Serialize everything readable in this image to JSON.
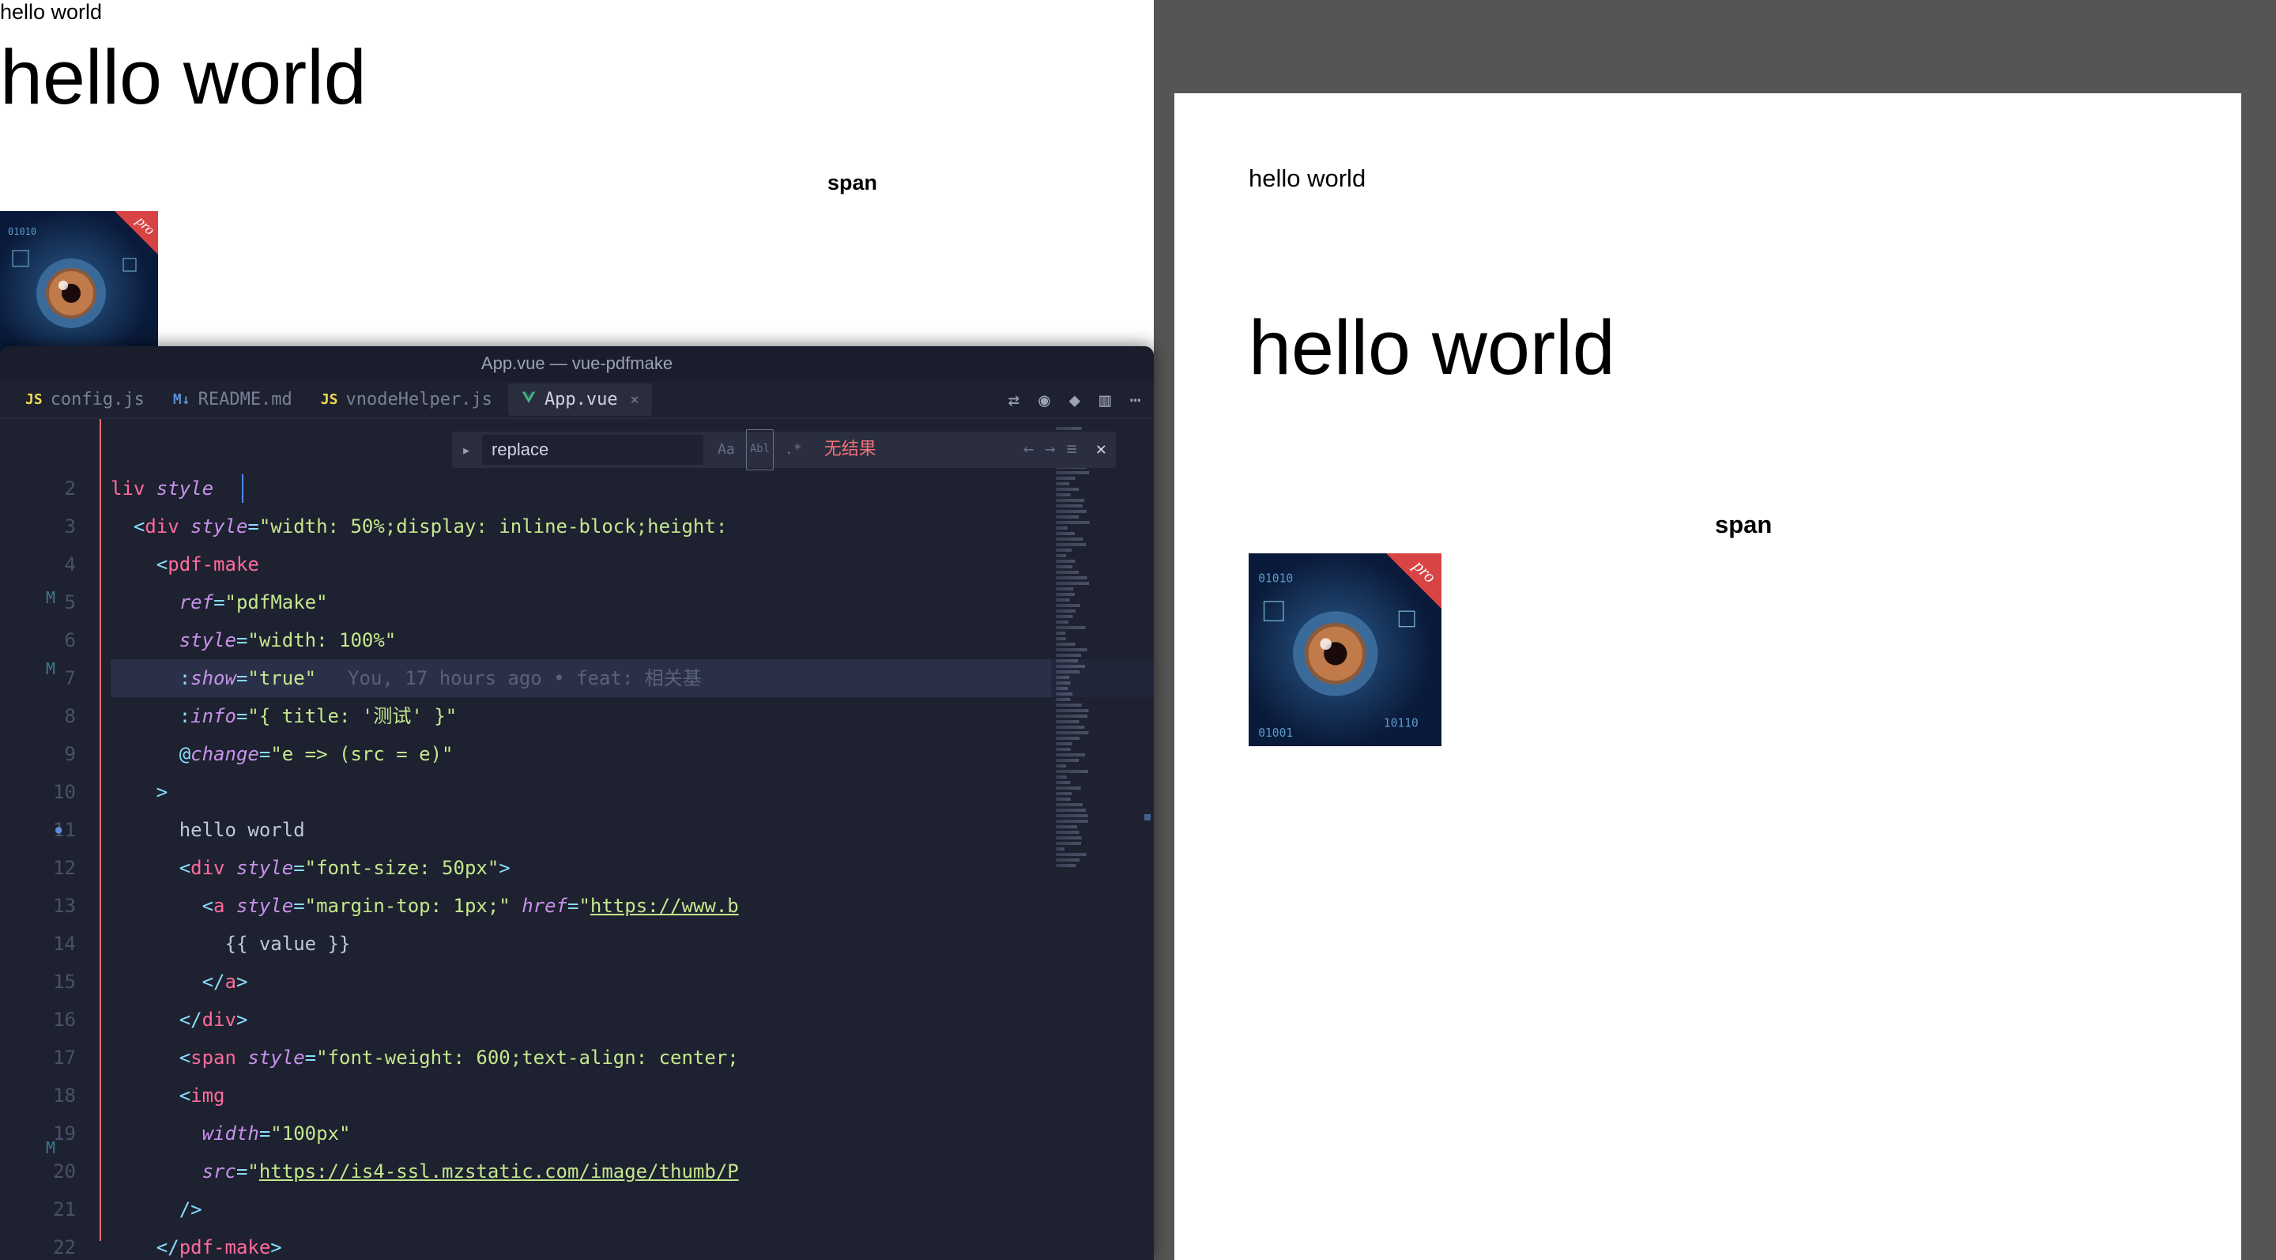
{
  "browser": {
    "text_small": "hello world",
    "text_big": "hello world",
    "span_label": "span"
  },
  "pdf": {
    "text_small": "hello world",
    "text_big": "hello world",
    "span_label": "span",
    "pro_badge": "pro"
  },
  "editor": {
    "title": "App.vue — vue-pdfmake",
    "tabs": [
      {
        "icon": "JS",
        "label": "config.js"
      },
      {
        "icon": "M↓",
        "label": "README.md"
      },
      {
        "icon": "JS",
        "label": "vnodeHelper.js"
      },
      {
        "icon": "V",
        "label": "App.vue",
        "active": true
      }
    ],
    "find": {
      "value": "replace",
      "result": "无结果"
    },
    "git_markers": {
      "m1": "M",
      "m2": "M",
      "m3": "M"
    },
    "blame": "You, 17 hours ago • feat: 相关基",
    "lines": [
      {
        "n": "2",
        "code_parts": [
          {
            "t": "liv ",
            "c": "tag"
          },
          {
            "t": "style",
            "c": "attr"
          }
        ],
        "raw": "liv style"
      },
      {
        "n": "3",
        "i": 1,
        "p": [
          {
            "t": "<",
            "c": "punc"
          },
          {
            "t": "div ",
            "c": "tag"
          },
          {
            "t": "style",
            "c": "attr"
          },
          {
            "t": "=",
            "c": "punc"
          },
          {
            "t": "\"width: 50%;display: inline-block;height:",
            "c": "str"
          }
        ]
      },
      {
        "n": "4",
        "i": 2,
        "p": [
          {
            "t": "<",
            "c": "punc"
          },
          {
            "t": "pdf-make",
            "c": "tag"
          }
        ]
      },
      {
        "n": "5",
        "i": 3,
        "p": [
          {
            "t": "ref",
            "c": "attr"
          },
          {
            "t": "=",
            "c": "punc"
          },
          {
            "t": "\"pdfMake\"",
            "c": "str"
          }
        ]
      },
      {
        "n": "6",
        "i": 3,
        "p": [
          {
            "t": "style",
            "c": "attr"
          },
          {
            "t": "=",
            "c": "punc"
          },
          {
            "t": "\"width: 100%\"",
            "c": "str"
          }
        ]
      },
      {
        "n": "7",
        "i": 3,
        "sel": true,
        "p": [
          {
            "t": ":",
            "c": "punc"
          },
          {
            "t": "show",
            "c": "attr"
          },
          {
            "t": "=",
            "c": "punc"
          },
          {
            "t": "\"true\"",
            "c": "str"
          }
        ],
        "blame": true
      },
      {
        "n": "8",
        "i": 3,
        "p": [
          {
            "t": ":",
            "c": "punc"
          },
          {
            "t": "info",
            "c": "attr"
          },
          {
            "t": "=",
            "c": "punc"
          },
          {
            "t": "\"{ title: '测试' }\"",
            "c": "str"
          }
        ]
      },
      {
        "n": "9",
        "i": 3,
        "p": [
          {
            "t": "@",
            "c": "punc"
          },
          {
            "t": "change",
            "c": "attr"
          },
          {
            "t": "=",
            "c": "punc"
          },
          {
            "t": "\"e => (src = e)\"",
            "c": "str"
          }
        ]
      },
      {
        "n": "10",
        "i": 2,
        "p": [
          {
            "t": ">",
            "c": "punc"
          }
        ]
      },
      {
        "n": "11",
        "i": 3,
        "p": [
          {
            "t": "hello world",
            "c": ""
          }
        ]
      },
      {
        "n": "12",
        "i": 3,
        "p": [
          {
            "t": "<",
            "c": "punc"
          },
          {
            "t": "div ",
            "c": "tag"
          },
          {
            "t": "style",
            "c": "attr"
          },
          {
            "t": "=",
            "c": "punc"
          },
          {
            "t": "\"font-size: 50px\"",
            "c": "str"
          },
          {
            "t": ">",
            "c": "punc"
          }
        ]
      },
      {
        "n": "13",
        "i": 4,
        "p": [
          {
            "t": "<",
            "c": "punc"
          },
          {
            "t": "a ",
            "c": "tag"
          },
          {
            "t": "style",
            "c": "attr"
          },
          {
            "t": "=",
            "c": "punc"
          },
          {
            "t": "\"margin-top: 1px;\" ",
            "c": "str"
          },
          {
            "t": "href",
            "c": "attr"
          },
          {
            "t": "=",
            "c": "punc"
          },
          {
            "t": "\"",
            "c": "str"
          },
          {
            "t": "https://www.b",
            "c": "url"
          }
        ]
      },
      {
        "n": "14",
        "i": 5,
        "p": [
          {
            "t": "{{ value }}",
            "c": ""
          }
        ]
      },
      {
        "n": "15",
        "i": 4,
        "p": [
          {
            "t": "</",
            "c": "punc"
          },
          {
            "t": "a",
            "c": "tag"
          },
          {
            "t": ">",
            "c": "punc"
          }
        ]
      },
      {
        "n": "16",
        "i": 3,
        "p": [
          {
            "t": "</",
            "c": "punc"
          },
          {
            "t": "div",
            "c": "tag"
          },
          {
            "t": ">",
            "c": "punc"
          }
        ]
      },
      {
        "n": "17",
        "i": 3,
        "p": [
          {
            "t": "<",
            "c": "punc"
          },
          {
            "t": "span ",
            "c": "tag"
          },
          {
            "t": "style",
            "c": "attr"
          },
          {
            "t": "=",
            "c": "punc"
          },
          {
            "t": "\"font-weight: 600;text-align: center;",
            "c": "str"
          }
        ]
      },
      {
        "n": "18",
        "i": 3,
        "p": [
          {
            "t": "<",
            "c": "punc"
          },
          {
            "t": "img",
            "c": "tag"
          }
        ]
      },
      {
        "n": "19",
        "i": 4,
        "p": [
          {
            "t": "width",
            "c": "attr"
          },
          {
            "t": "=",
            "c": "punc"
          },
          {
            "t": "\"100px\"",
            "c": "str"
          }
        ]
      },
      {
        "n": "20",
        "i": 4,
        "p": [
          {
            "t": "src",
            "c": "attr"
          },
          {
            "t": "=",
            "c": "punc"
          },
          {
            "t": "\"",
            "c": "str"
          },
          {
            "t": "https://is4-ssl.mzstatic.com/image/thumb/P",
            "c": "url"
          }
        ]
      },
      {
        "n": "21",
        "i": 3,
        "p": [
          {
            "t": "/>",
            "c": "punc"
          }
        ]
      },
      {
        "n": "22",
        "i": 2,
        "p": [
          {
            "t": "</",
            "c": "punc"
          },
          {
            "t": "pdf-make",
            "c": "tag"
          },
          {
            "t": ">",
            "c": "punc"
          }
        ]
      }
    ]
  }
}
